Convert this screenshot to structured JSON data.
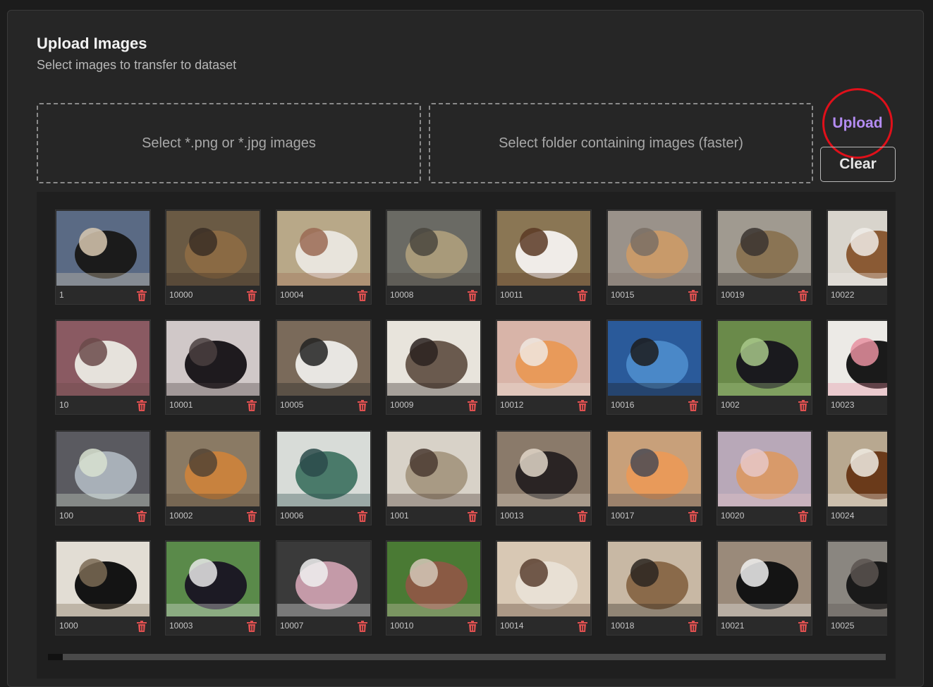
{
  "header": {
    "title": "Upload Images",
    "subtitle": "Select images to transfer to dataset"
  },
  "dropzones": {
    "files_label": "Select *.png or *.jpg images",
    "folder_label": "Select folder containing images (faster)"
  },
  "actions": {
    "upload_label": "Upload",
    "clear_label": "Clear"
  },
  "gallery": {
    "columns": [
      [
        "1",
        "10",
        "100",
        "1000"
      ],
      [
        "10000",
        "10001",
        "10002",
        "10003"
      ],
      [
        "10004",
        "10005",
        "10006",
        "10007"
      ],
      [
        "10008",
        "10009",
        "1001",
        "10010"
      ],
      [
        "10011",
        "10012",
        "10013",
        "10014"
      ],
      [
        "10015",
        "10016",
        "10017",
        "10018"
      ],
      [
        "10019",
        "1002",
        "10020",
        "10021"
      ],
      [
        "10022",
        "10023",
        "10024",
        "10025"
      ]
    ],
    "colors": {
      "1": [
        "#5a6a84",
        "#1b1b1b",
        "#d8c8b0"
      ],
      "10": [
        "#8a5a62",
        "#e6e2dc",
        "#6a4a4a"
      ],
      "100": [
        "#5a5a60",
        "#a8b0b8",
        "#d8e2d0"
      ],
      "1000": [
        "#e2ddd4",
        "#141414",
        "#7a6a54"
      ],
      "10000": [
        "#6a5a44",
        "#8a6a44",
        "#3a2e24"
      ],
      "10001": [
        "#d0c8c8",
        "#1e1a1e",
        "#4a4040"
      ],
      "10002": [
        "#8a7a64",
        "#c8823e",
        "#544434"
      ],
      "10003": [
        "#5a8a4a",
        "#1c1a24",
        "#e8e8e8"
      ],
      "10004": [
        "#b8a888",
        "#e8e4dc",
        "#9a6a54"
      ],
      "10005": [
        "#7a6a5a",
        "#e8e6e2",
        "#222222"
      ],
      "10006": [
        "#d8dcd8",
        "#4a7a6a",
        "#2a4a4a"
      ],
      "10007": [
        "#3a3a3a",
        "#c49aa8",
        "#f0f0f0"
      ],
      "10008": [
        "#6a6a64",
        "#a89a7a",
        "#4a463e"
      ],
      "10009": [
        "#e8e4dc",
        "#6a5a4e",
        "#2a2220"
      ],
      "1001": [
        "#d8d2c8",
        "#a89a84",
        "#4a3a30"
      ],
      "10010": [
        "#4a7a34",
        "#8a5a44",
        "#d4c8b8"
      ],
      "10011": [
        "#8a7654",
        "#f0ece8",
        "#5a3a24"
      ],
      "10012": [
        "#d8b4a8",
        "#e89a5a",
        "#f0e8e0"
      ],
      "10013": [
        "#8a7a6a",
        "#2a2424",
        "#e0d6c8"
      ],
      "10014": [
        "#d8c8b4",
        "#e8e0d4",
        "#5a4030"
      ],
      "10015": [
        "#9a928a",
        "#c89a6a",
        "#7a6e64"
      ],
      "10016": [
        "#2a5a9a",
        "#4a88c8",
        "#1c1c1c"
      ],
      "10017": [
        "#c8a07a",
        "#e89a5a",
        "#4a4a54"
      ],
      "10018": [
        "#c8b8a4",
        "#8a6a4a",
        "#2a2420"
      ],
      "10019": [
        "#a09a90",
        "#8a7454",
        "#3a3430"
      ],
      "1002": [
        "#6a8a4a",
        "#1a1a1e",
        "#a8c88a"
      ],
      "10020": [
        "#b8a8b8",
        "#d89a6a",
        "#e8c8c8"
      ],
      "10021": [
        "#9a8a7a",
        "#141414",
        "#f0f0f0"
      ],
      "10022": [
        "#d8d4cc",
        "#8a5a34",
        "#f0ece8"
      ],
      "10023": [
        "#eceae6",
        "#1a1a1a",
        "#e890a0"
      ],
      "10024": [
        "#b8a890",
        "#6a3a1a",
        "#f0ece4"
      ],
      "10025": [
        "#8a8680",
        "#1a1a1a",
        "#5a5450"
      ]
    }
  }
}
